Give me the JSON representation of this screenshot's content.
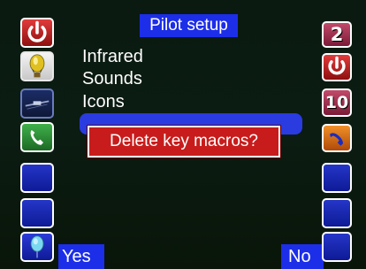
{
  "header": {
    "title": "Pilot setup"
  },
  "menu": {
    "items": [
      {
        "label": "Infrared"
      },
      {
        "label": "Sounds"
      },
      {
        "label": "Icons"
      }
    ]
  },
  "dialog": {
    "message": "Delete key macros?"
  },
  "softkeys": {
    "yes_label": "Yes",
    "no_label": "No"
  },
  "left_slots": [
    {
      "icon": "power-icon",
      "color": "#d32a2a"
    },
    {
      "icon": "balloon-icon",
      "color": "#f0f0f0"
    },
    {
      "icon": "satellite-dish-icon",
      "color": "#1b2c66"
    },
    {
      "icon": "phone-icon",
      "color": "#2f9a3a"
    },
    {
      "icon": "empty-slot",
      "color": "#1a2bc0"
    },
    {
      "icon": "empty-slot",
      "color": "#1a2bc0"
    },
    {
      "icon": "balloon-icon",
      "color": "#1a2bc0"
    }
  ],
  "right_slots": [
    {
      "icon": "number-badge",
      "value": "2",
      "color": "#b83a5a"
    },
    {
      "icon": "power-icon",
      "color": "#d32a2a"
    },
    {
      "icon": "number-badge",
      "value": "10",
      "color": "#b83a5a"
    },
    {
      "icon": "phone-hangup-icon",
      "color": "#e07a1e"
    },
    {
      "icon": "empty-slot",
      "color": "#1a2bc0"
    },
    {
      "icon": "empty-slot",
      "color": "#1a2bc0"
    },
    {
      "icon": "empty-slot",
      "color": "#1a2bc0"
    }
  ]
}
